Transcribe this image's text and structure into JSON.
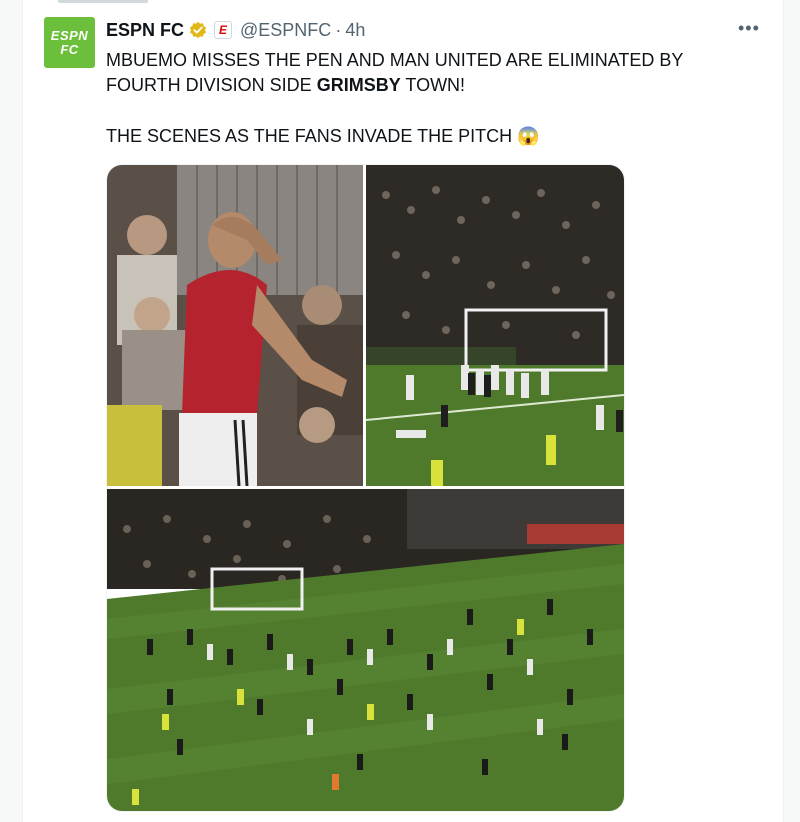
{
  "tweet": {
    "display_name": "ESPN FC",
    "handle": "@ESPNFC",
    "separator": "·",
    "time": "4h",
    "more_label": "•••",
    "avatar_line1": "ESPN",
    "avatar_line2": "FC",
    "org_badge_letter": "E",
    "text_line1": "MBUEMO MISSES THE PEN AND MAN UNITED ARE ELIMINATED BY",
    "text_line2_part1": "FOURTH DIVISION SIDE ",
    "text_line2_bold": "GRIMSBY",
    "text_line2_part2": " TOWN!",
    "text_line3": "THE SCENES AS THE FANS INVADE THE PITCH",
    "emoji": "😱"
  },
  "media": {
    "images": [
      {
        "name": "player-head-in-hands-photo"
      },
      {
        "name": "players-celebrate-goal-photo"
      },
      {
        "name": "fans-invade-pitch-photo"
      }
    ]
  },
  "colors": {
    "avatar_green": "#6bbf3b",
    "verified_gold": "#e2b719",
    "muted_text": "#536471",
    "pitch_green": "#4f7a2c"
  }
}
